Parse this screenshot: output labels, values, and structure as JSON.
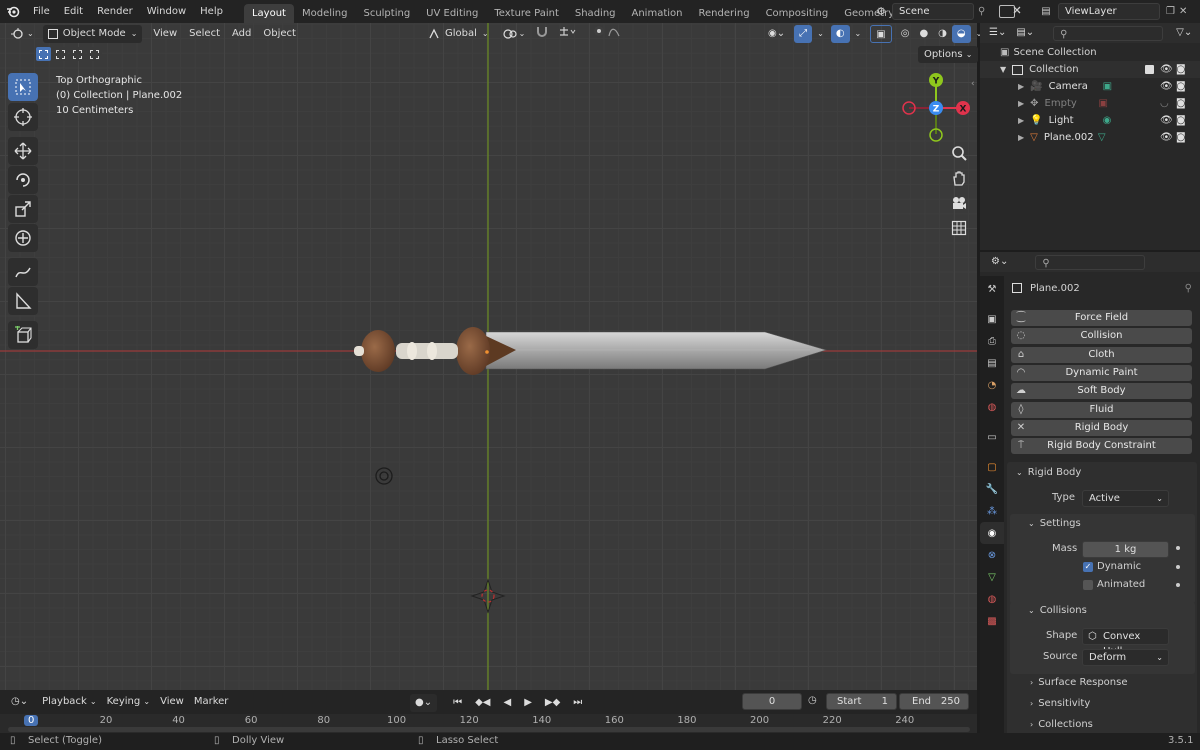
{
  "menu": {
    "file": "File",
    "edit": "Edit",
    "render": "Render",
    "window": "Window",
    "help": "Help"
  },
  "workspaces": [
    {
      "label": "Layout",
      "active": true
    },
    {
      "label": "Modeling"
    },
    {
      "label": "Sculpting"
    },
    {
      "label": "UV Editing"
    },
    {
      "label": "Texture Paint"
    },
    {
      "label": "Shading"
    },
    {
      "label": "Animation"
    },
    {
      "label": "Rendering"
    },
    {
      "label": "Compositing"
    },
    {
      "label": "Geometry Nodes"
    }
  ],
  "scene": {
    "name": "Scene",
    "view_layer": "ViewLayer"
  },
  "viewport_header": {
    "mode": "Object Mode",
    "view": "View",
    "select": "Select",
    "add": "Add",
    "object": "Object",
    "orientation": "Global",
    "options": "Options"
  },
  "viewport_overlay": {
    "view_name": "Top Orthographic",
    "collection_info": "(0) Collection | Plane.002",
    "scale": "10 Centimeters"
  },
  "gizmo": {
    "y": "Y",
    "z": "Z",
    "x": "X"
  },
  "outliner": {
    "root": "Scene Collection",
    "collection": "Collection",
    "items": [
      {
        "label": "Camera",
        "color": "#e07b39"
      },
      {
        "label": "Empty",
        "color": "#9a9a9a",
        "dim": true
      },
      {
        "label": "Light",
        "color": "#e8b84a"
      },
      {
        "label": "Plane.002",
        "color": "#e07b39"
      }
    ]
  },
  "properties": {
    "object_name": "Plane.002",
    "physics_buttons": [
      "Force Field",
      "Collision",
      "Cloth",
      "Dynamic Paint",
      "Soft Body",
      "Fluid",
      "Rigid Body",
      "Rigid Body Constraint"
    ],
    "rigid_body": {
      "panel": "Rigid Body",
      "type_label": "Type",
      "type_value": "Active",
      "settings": "Settings",
      "mass_label": "Mass",
      "mass_value": "1 kg",
      "dynamic": "Dynamic",
      "dynamic_checked": true,
      "animated": "Animated",
      "animated_checked": false,
      "collisions": "Collisions",
      "shape_label": "Shape",
      "shape_value": "Convex Hull",
      "source_label": "Source",
      "source_value": "Deform",
      "surface_response": "Surface Response",
      "sensitivity": "Sensitivity",
      "collections": "Collections"
    }
  },
  "timeline": {
    "playback": "Playback",
    "keying": "Keying",
    "view": "View",
    "marker": "Marker",
    "current_frame": "0",
    "start_label": "Start",
    "start": "1",
    "end_label": "End",
    "end": "250",
    "ruler": [
      "0",
      "20",
      "40",
      "60",
      "80",
      "100",
      "120",
      "140",
      "160",
      "180",
      "200",
      "220",
      "240"
    ]
  },
  "statusbar": {
    "select": "Select (Toggle)",
    "dolly": "Dolly View",
    "lasso": "Lasso Select",
    "version": "3.5.1"
  },
  "colors": {
    "accent": "#4772b3",
    "x_axis": "#a33a3a",
    "y_axis": "#6c8e23",
    "gizmo_x": "#e0334c",
    "gizmo_y": "#8fc71d",
    "gizmo_z": "#3a8cf0"
  }
}
